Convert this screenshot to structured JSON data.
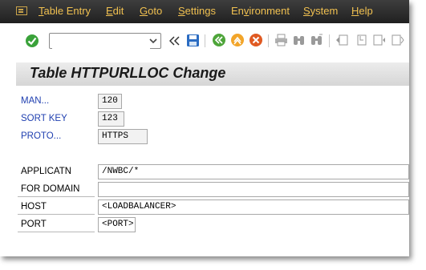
{
  "menubar": {
    "items": [
      {
        "prefix": "",
        "u": "T",
        "rest": "able Entry"
      },
      {
        "prefix": "",
        "u": "E",
        "rest": "dit"
      },
      {
        "prefix": "",
        "u": "G",
        "rest": "oto"
      },
      {
        "prefix": "",
        "u": "S",
        "rest": "ettings"
      },
      {
        "prefix": "En",
        "u": "v",
        "rest": "ironment"
      },
      {
        "prefix": "",
        "u": "S",
        "rest": "ystem"
      },
      {
        "prefix": "",
        "u": "H",
        "rest": "elp"
      }
    ]
  },
  "toolbar": {
    "command_field_value": "",
    "icons": [
      "confirm-icon",
      "dropdown-icon",
      "collapse-icon",
      "save-icon",
      "back-icon",
      "exit-icon",
      "cancel-icon",
      "print-icon",
      "find-icon",
      "find-next-icon",
      "first-page-icon",
      "previous-page-icon",
      "next-page-icon"
    ]
  },
  "screen": {
    "title": "Table HTTPURLLOC Change"
  },
  "keys": [
    {
      "label": "MAN...",
      "value": "120"
    },
    {
      "label": "SORT KEY",
      "value": "123"
    },
    {
      "label": "PROTO...",
      "value": "HTTPS"
    }
  ],
  "fields": [
    {
      "label": "APPLICATN",
      "value": "/NWBC/*"
    },
    {
      "label": "FOR DOMAIN",
      "value": ""
    },
    {
      "label": "HOST",
      "value": "<LOADBALANCER>"
    },
    {
      "label": "PORT",
      "value": "<PORT>"
    }
  ],
  "colors": {
    "menubar_bg": "#2c2c2c",
    "menu_text": "#f0c050",
    "key_label": "#1f3fb0",
    "title_bar": "#e0e0e0"
  }
}
